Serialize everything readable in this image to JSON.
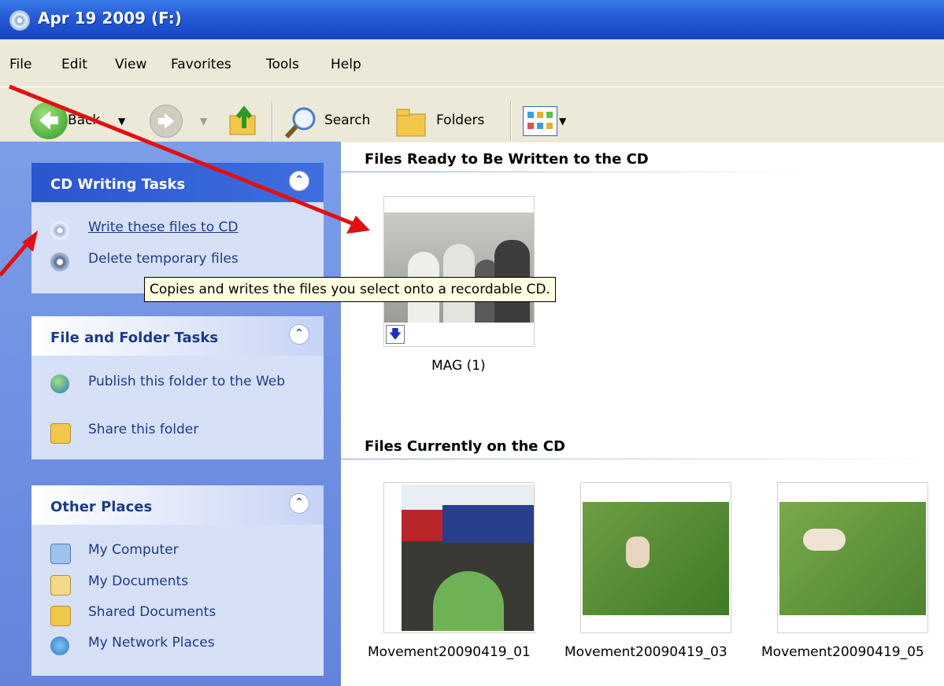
{
  "window": {
    "title": "Apr 19 2009 (F:)"
  },
  "menu": [
    "File",
    "Edit",
    "View",
    "Favorites",
    "Tools",
    "Help"
  ],
  "toolbar": {
    "back_label": "Back",
    "search_label": "Search",
    "folders_label": "Folders"
  },
  "sidebar": {
    "cd_tasks": {
      "title": "CD Writing Tasks",
      "items": [
        "Write these files to CD",
        "Delete temporary files"
      ]
    },
    "file_tasks": {
      "title": "File and Folder Tasks",
      "items": [
        "Publish this folder to the Web",
        "Share this folder"
      ]
    },
    "other_places": {
      "title": "Other Places",
      "items": [
        "My Computer",
        "My Documents",
        "Shared Documents",
        "My Network Places"
      ]
    }
  },
  "tooltip": "Copies and writes the files you select onto a recordable CD.",
  "main": {
    "ready_heading": "Files Ready to Be Written to the CD",
    "ready_files": [
      "MAG (1)"
    ],
    "current_heading": "Files Currently on the CD",
    "current_files": [
      "Movement20090419_01",
      "Movement20090419_03",
      "Movement20090419_05"
    ]
  },
  "colors": {
    "title_bar": "#2459d6",
    "sidebar": "#6f8fe2",
    "panel": "#d6e0f7",
    "panel_head_dark": "#2d5bd6",
    "arrow": "#e01010"
  }
}
